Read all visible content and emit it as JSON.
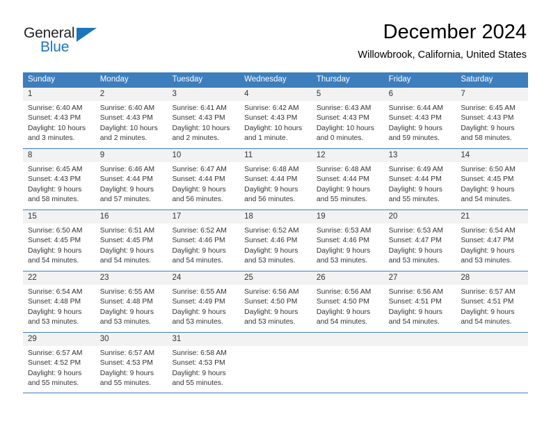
{
  "brand": {
    "name_top": "General",
    "name_bottom": "Blue",
    "accent_color": "#1b76bc"
  },
  "header": {
    "title": "December 2024",
    "subtitle": "Willowbrook, California, United States"
  },
  "theme": {
    "header_row_color": "#3d7ebd",
    "daynum_strip_color": "#f2f2f2",
    "text_color": "#333333"
  },
  "weekdays": [
    "Sunday",
    "Monday",
    "Tuesday",
    "Wednesday",
    "Thursday",
    "Friday",
    "Saturday"
  ],
  "weeks": [
    [
      {
        "day": "1",
        "sunrise": "Sunrise: 6:40 AM",
        "sunset": "Sunset: 4:43 PM",
        "daylight_line1": "Daylight: 10 hours",
        "daylight_line2": "and 3 minutes."
      },
      {
        "day": "2",
        "sunrise": "Sunrise: 6:40 AM",
        "sunset": "Sunset: 4:43 PM",
        "daylight_line1": "Daylight: 10 hours",
        "daylight_line2": "and 2 minutes."
      },
      {
        "day": "3",
        "sunrise": "Sunrise: 6:41 AM",
        "sunset": "Sunset: 4:43 PM",
        "daylight_line1": "Daylight: 10 hours",
        "daylight_line2": "and 2 minutes."
      },
      {
        "day": "4",
        "sunrise": "Sunrise: 6:42 AM",
        "sunset": "Sunset: 4:43 PM",
        "daylight_line1": "Daylight: 10 hours",
        "daylight_line2": "and 1 minute."
      },
      {
        "day": "5",
        "sunrise": "Sunrise: 6:43 AM",
        "sunset": "Sunset: 4:43 PM",
        "daylight_line1": "Daylight: 10 hours",
        "daylight_line2": "and 0 minutes."
      },
      {
        "day": "6",
        "sunrise": "Sunrise: 6:44 AM",
        "sunset": "Sunset: 4:43 PM",
        "daylight_line1": "Daylight: 9 hours",
        "daylight_line2": "and 59 minutes."
      },
      {
        "day": "7",
        "sunrise": "Sunrise: 6:45 AM",
        "sunset": "Sunset: 4:43 PM",
        "daylight_line1": "Daylight: 9 hours",
        "daylight_line2": "and 58 minutes."
      }
    ],
    [
      {
        "day": "8",
        "sunrise": "Sunrise: 6:45 AM",
        "sunset": "Sunset: 4:43 PM",
        "daylight_line1": "Daylight: 9 hours",
        "daylight_line2": "and 58 minutes."
      },
      {
        "day": "9",
        "sunrise": "Sunrise: 6:46 AM",
        "sunset": "Sunset: 4:44 PM",
        "daylight_line1": "Daylight: 9 hours",
        "daylight_line2": "and 57 minutes."
      },
      {
        "day": "10",
        "sunrise": "Sunrise: 6:47 AM",
        "sunset": "Sunset: 4:44 PM",
        "daylight_line1": "Daylight: 9 hours",
        "daylight_line2": "and 56 minutes."
      },
      {
        "day": "11",
        "sunrise": "Sunrise: 6:48 AM",
        "sunset": "Sunset: 4:44 PM",
        "daylight_line1": "Daylight: 9 hours",
        "daylight_line2": "and 56 minutes."
      },
      {
        "day": "12",
        "sunrise": "Sunrise: 6:48 AM",
        "sunset": "Sunset: 4:44 PM",
        "daylight_line1": "Daylight: 9 hours",
        "daylight_line2": "and 55 minutes."
      },
      {
        "day": "13",
        "sunrise": "Sunrise: 6:49 AM",
        "sunset": "Sunset: 4:44 PM",
        "daylight_line1": "Daylight: 9 hours",
        "daylight_line2": "and 55 minutes."
      },
      {
        "day": "14",
        "sunrise": "Sunrise: 6:50 AM",
        "sunset": "Sunset: 4:45 PM",
        "daylight_line1": "Daylight: 9 hours",
        "daylight_line2": "and 54 minutes."
      }
    ],
    [
      {
        "day": "15",
        "sunrise": "Sunrise: 6:50 AM",
        "sunset": "Sunset: 4:45 PM",
        "daylight_line1": "Daylight: 9 hours",
        "daylight_line2": "and 54 minutes."
      },
      {
        "day": "16",
        "sunrise": "Sunrise: 6:51 AM",
        "sunset": "Sunset: 4:45 PM",
        "daylight_line1": "Daylight: 9 hours",
        "daylight_line2": "and 54 minutes."
      },
      {
        "day": "17",
        "sunrise": "Sunrise: 6:52 AM",
        "sunset": "Sunset: 4:46 PM",
        "daylight_line1": "Daylight: 9 hours",
        "daylight_line2": "and 54 minutes."
      },
      {
        "day": "18",
        "sunrise": "Sunrise: 6:52 AM",
        "sunset": "Sunset: 4:46 PM",
        "daylight_line1": "Daylight: 9 hours",
        "daylight_line2": "and 53 minutes."
      },
      {
        "day": "19",
        "sunrise": "Sunrise: 6:53 AM",
        "sunset": "Sunset: 4:46 PM",
        "daylight_line1": "Daylight: 9 hours",
        "daylight_line2": "and 53 minutes."
      },
      {
        "day": "20",
        "sunrise": "Sunrise: 6:53 AM",
        "sunset": "Sunset: 4:47 PM",
        "daylight_line1": "Daylight: 9 hours",
        "daylight_line2": "and 53 minutes."
      },
      {
        "day": "21",
        "sunrise": "Sunrise: 6:54 AM",
        "sunset": "Sunset: 4:47 PM",
        "daylight_line1": "Daylight: 9 hours",
        "daylight_line2": "and 53 minutes."
      }
    ],
    [
      {
        "day": "22",
        "sunrise": "Sunrise: 6:54 AM",
        "sunset": "Sunset: 4:48 PM",
        "daylight_line1": "Daylight: 9 hours",
        "daylight_line2": "and 53 minutes."
      },
      {
        "day": "23",
        "sunrise": "Sunrise: 6:55 AM",
        "sunset": "Sunset: 4:48 PM",
        "daylight_line1": "Daylight: 9 hours",
        "daylight_line2": "and 53 minutes."
      },
      {
        "day": "24",
        "sunrise": "Sunrise: 6:55 AM",
        "sunset": "Sunset: 4:49 PM",
        "daylight_line1": "Daylight: 9 hours",
        "daylight_line2": "and 53 minutes."
      },
      {
        "day": "25",
        "sunrise": "Sunrise: 6:56 AM",
        "sunset": "Sunset: 4:50 PM",
        "daylight_line1": "Daylight: 9 hours",
        "daylight_line2": "and 53 minutes."
      },
      {
        "day": "26",
        "sunrise": "Sunrise: 6:56 AM",
        "sunset": "Sunset: 4:50 PM",
        "daylight_line1": "Daylight: 9 hours",
        "daylight_line2": "and 54 minutes."
      },
      {
        "day": "27",
        "sunrise": "Sunrise: 6:56 AM",
        "sunset": "Sunset: 4:51 PM",
        "daylight_line1": "Daylight: 9 hours",
        "daylight_line2": "and 54 minutes."
      },
      {
        "day": "28",
        "sunrise": "Sunrise: 6:57 AM",
        "sunset": "Sunset: 4:51 PM",
        "daylight_line1": "Daylight: 9 hours",
        "daylight_line2": "and 54 minutes."
      }
    ],
    [
      {
        "day": "29",
        "sunrise": "Sunrise: 6:57 AM",
        "sunset": "Sunset: 4:52 PM",
        "daylight_line1": "Daylight: 9 hours",
        "daylight_line2": "and 55 minutes."
      },
      {
        "day": "30",
        "sunrise": "Sunrise: 6:57 AM",
        "sunset": "Sunset: 4:53 PM",
        "daylight_line1": "Daylight: 9 hours",
        "daylight_line2": "and 55 minutes."
      },
      {
        "day": "31",
        "sunrise": "Sunrise: 6:58 AM",
        "sunset": "Sunset: 4:53 PM",
        "daylight_line1": "Daylight: 9 hours",
        "daylight_line2": "and 55 minutes."
      },
      {
        "day": "",
        "sunrise": "",
        "sunset": "",
        "daylight_line1": "",
        "daylight_line2": ""
      },
      {
        "day": "",
        "sunrise": "",
        "sunset": "",
        "daylight_line1": "",
        "daylight_line2": ""
      },
      {
        "day": "",
        "sunrise": "",
        "sunset": "",
        "daylight_line1": "",
        "daylight_line2": ""
      },
      {
        "day": "",
        "sunrise": "",
        "sunset": "",
        "daylight_line1": "",
        "daylight_line2": ""
      }
    ]
  ]
}
